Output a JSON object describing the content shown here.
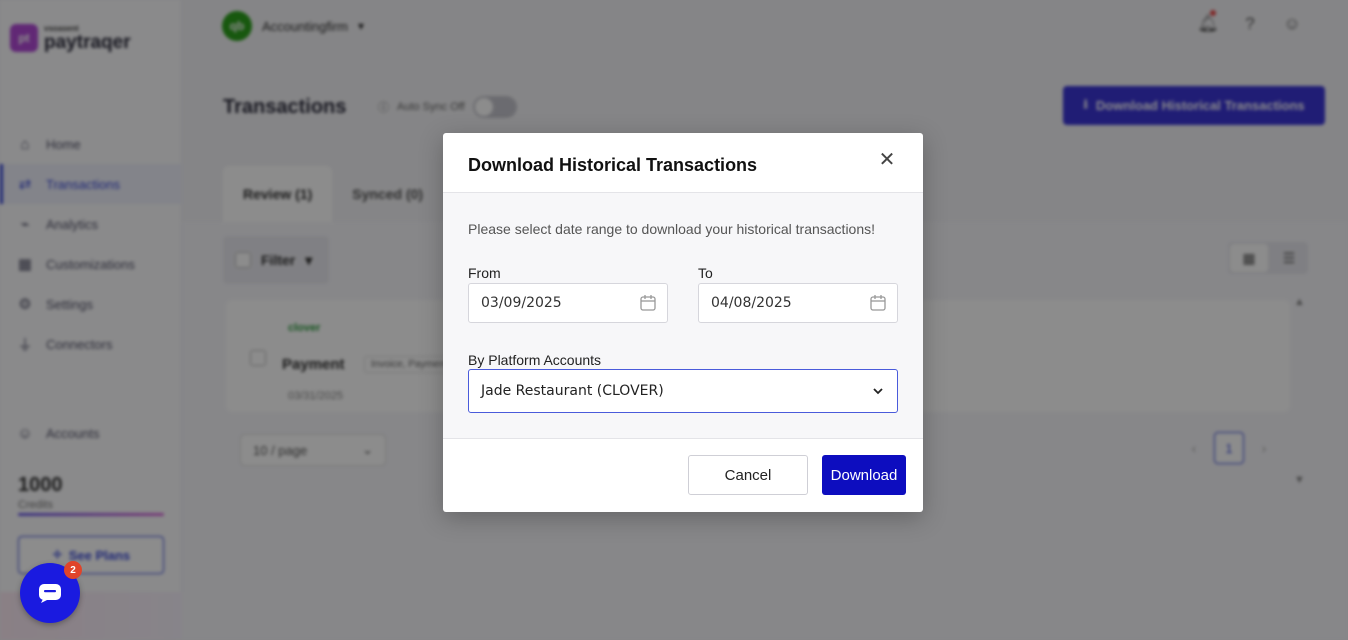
{
  "brand": {
    "sub": "vsoasent",
    "name": "paytraqer",
    "logo": "pt"
  },
  "sidebar": {
    "items": [
      {
        "label": "Home",
        "icon": "home-icon"
      },
      {
        "label": "Transactions",
        "icon": "arrows-icon"
      },
      {
        "label": "Analytics",
        "icon": "chart-icon"
      },
      {
        "label": "Customizations",
        "icon": "puzzle-icon"
      },
      {
        "label": "Settings",
        "icon": "gear-icon"
      },
      {
        "label": "Connectors",
        "icon": "plug-icon"
      }
    ],
    "accounts": "Accounts",
    "credits_value": "1000",
    "credits_label": "Credits",
    "plans_label": "See Plans"
  },
  "org": {
    "name": "Accountingfirm",
    "logo": "qb"
  },
  "page": {
    "title": "Transactions",
    "autosync_label": "Auto Sync Off",
    "download_hist_label": "Download Historical Transactions",
    "tabs": [
      {
        "label": "Review (1)"
      },
      {
        "label": "Synced (0)"
      }
    ],
    "filter_label": "Filter"
  },
  "transaction": {
    "source": "clover",
    "title": "Payment",
    "tag": "Invoice, Payment",
    "date": "03/31/2025"
  },
  "pagination": {
    "page_size": "10 / page",
    "current_page": "1"
  },
  "chat": {
    "badge": "2"
  },
  "modal": {
    "title": "Download Historical Transactions",
    "description": "Please select date range to download your historical transactions!",
    "from_label": "From",
    "from_value": "03/09/2025",
    "to_label": "To",
    "to_value": "04/08/2025",
    "platform_label": "By Platform Accounts",
    "platform_value": "Jade Restaurant (CLOVER)",
    "cancel_label": "Cancel",
    "download_label": "Download"
  },
  "colors": {
    "primary": "#3b35d6",
    "download_button": "#0d0dbf",
    "accent_brand": "#b14ad6"
  }
}
